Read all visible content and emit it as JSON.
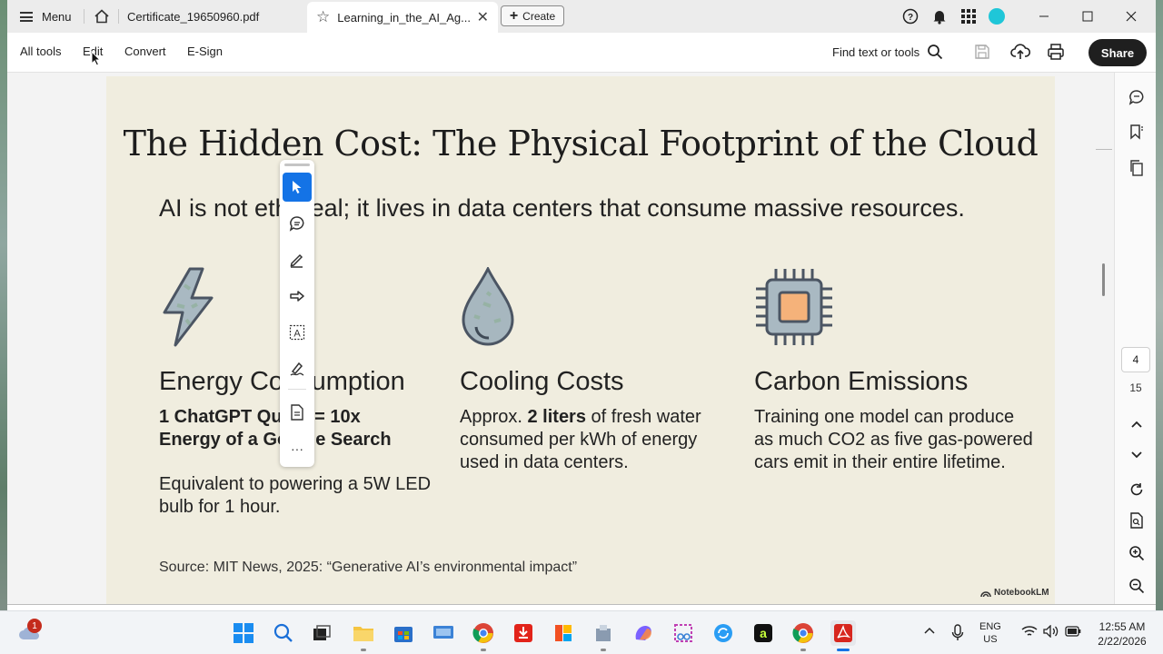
{
  "window": {
    "menu_label": "Menu",
    "tabs": [
      {
        "label": "Certificate_19650960.pdf"
      },
      {
        "label": "Learning_in_the_AI_Ag..."
      }
    ],
    "create_label": "Create"
  },
  "toolbar": {
    "menus": [
      "All tools",
      "Edit",
      "Convert",
      "E-Sign"
    ],
    "find_label": "Find text or tools",
    "share_label": "Share"
  },
  "slide": {
    "title": "The Hidden Cost: The Physical Footprint of the Cloud",
    "subtitle": "AI is not ethereal; it lives in data centers that consume massive resources.",
    "columns": [
      {
        "icon": "lightning-icon",
        "title": "Energy Consumption",
        "bold_line1": "1 ChatGPT Query = 10x",
        "bold_line2": "Energy of a Google Search",
        "note": "Equivalent to powering a 5W LED bulb for 1 hour."
      },
      {
        "icon": "water-drop-icon",
        "title": "Cooling Costs",
        "text_pre": "Approx. ",
        "text_bold": "2 liters",
        "text_post": " of fresh water consumed per kWh of energy used in data centers."
      },
      {
        "icon": "chip-icon",
        "title": "Carbon Emissions",
        "text": "Training one model can produce as much CO2 as five gas-powered cars emit in their entire lifetime."
      }
    ],
    "source": "Source: MIT News, 2025: “Generative AI’s environmental impact”",
    "badge": "NotebookLM"
  },
  "navigation": {
    "current_page": "4",
    "total_pages": "15"
  },
  "taskbar": {
    "weather_badge": "1",
    "lang_line1": "ENG",
    "lang_line2": "US",
    "time": "12:55 AM",
    "date": "2/22/2026"
  },
  "colors": {
    "accent": "#1473e6",
    "page_bg": "#f0eddf",
    "share_bg": "#1f1f1f"
  }
}
